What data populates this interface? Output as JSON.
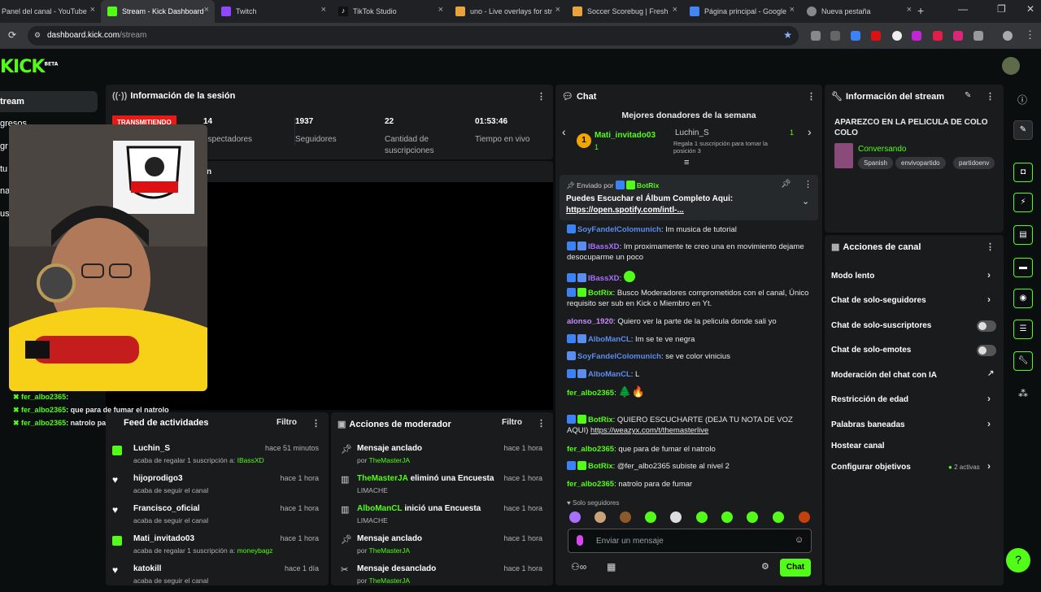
{
  "browser": {
    "tabs": [
      {
        "title": "Panel del canal - YouTube",
        "active": false
      },
      {
        "title": "Stream - Kick Dashboard",
        "active": true
      },
      {
        "title": "Twitch",
        "active": false
      },
      {
        "title": "TikTok Studio",
        "active": false
      },
      {
        "title": "uno - Live overlays for str",
        "active": false
      },
      {
        "title": "Soccer Scorebug | Fresh",
        "active": false
      },
      {
        "title": "Página principal - Google",
        "active": false
      },
      {
        "title": "Nueva pestaña",
        "active": false
      }
    ],
    "url_host": "dashboard.kick.com",
    "url_path": "/stream"
  },
  "app": {
    "logo": "KICK",
    "beta": "BETA"
  },
  "sidenav": {
    "items": [
      "tream",
      "gresos",
      "gr",
      "tu",
      "na",
      "us"
    ]
  },
  "session": {
    "title": "Información de la sesión",
    "live_label": "TRANSMITIENDO",
    "stats": [
      {
        "value": "14",
        "label": "espectadores"
      },
      {
        "value": "1937",
        "label": "Seguidores"
      },
      {
        "value": "22",
        "label": "Cantidad de suscripciones"
      },
      {
        "value": "01:53:46",
        "label": "Tiempo en vivo"
      }
    ],
    "preview_label": "n"
  },
  "overlay_chat": [
    {
      "user": "fer_albo2365",
      "text": ":"
    },
    {
      "user": "fer_albo2365",
      "text": ": que para de fumar el natrolo"
    },
    {
      "user": "fer_albo2365",
      "text": ": natrolo para de fumar"
    }
  ],
  "activity": {
    "title": "Feed de actividades",
    "filter": "Filtro",
    "items": [
      {
        "name": "Luchin_S",
        "time": "hace 51 minutos",
        "desc": "acaba de regalar 1 suscripción a:",
        "highlight": "IBassXD",
        "icon": "gift"
      },
      {
        "name": "hijoprodigo3",
        "time": "hace 1 hora",
        "desc": "acaba de seguir el canal",
        "highlight": "",
        "icon": "heart"
      },
      {
        "name": "Francisco_oficial",
        "time": "hace 1 hora",
        "desc": "acaba de seguir el canal",
        "highlight": "",
        "icon": "heart"
      },
      {
        "name": "Mati_invitado03",
        "time": "hace 1 hora",
        "desc": "acaba de regalar 1 suscripción a:",
        "highlight": "moneybagz",
        "icon": "gift"
      },
      {
        "name": "katokill",
        "time": "hace 1 día",
        "desc": "acaba de seguir el canal",
        "highlight": "",
        "icon": "heart"
      }
    ]
  },
  "moderator": {
    "title": "Acciones de moderador",
    "filter": "Filtro",
    "items": [
      {
        "actor": "",
        "action": "Mensaje anclado",
        "time": "hace 1 hora",
        "prefix": "por",
        "detail": "TheMasterJA"
      },
      {
        "actor": "TheMasterJA",
        "action": " eliminó una Encuesta",
        "time": "hace 1 hora",
        "prefix": "",
        "detail": "LIMACHE"
      },
      {
        "actor": "AlboManCL",
        "action": " inició una Encuesta",
        "time": "hace 1 hora",
        "prefix": "",
        "detail": "LIMACHE"
      },
      {
        "actor": "",
        "action": "Mensaje anclado",
        "time": "hace 1 hora",
        "prefix": "por",
        "detail": "TheMasterJA"
      },
      {
        "actor": "",
        "action": "Mensaje desanclado",
        "time": "hace 1 hora",
        "prefix": "por",
        "detail": "TheMasterJA"
      }
    ]
  },
  "chat": {
    "title": "Chat",
    "donors_title": "Mejores donadores de la semana",
    "donor1": {
      "rank": "1",
      "name": "Mati_invitado03",
      "count": "1"
    },
    "donor2": {
      "name": "Luchin_S",
      "count": "1",
      "note": "Regala 1 suscripción para tomar la posición 3"
    },
    "pinned": {
      "sent_by": "Enviado por",
      "user": "BotRix",
      "text": "Puedes Escuchar el Álbum Completo Aqui:",
      "link": "https://open.spotify.com/intl-..."
    },
    "messages": [
      {
        "user": "SoyFandelColomunich",
        "color": "#5b8def",
        "text": ": Im musica de tutorial"
      },
      {
        "user": "IBassXD",
        "color": "#a970ff",
        "text": ": Im proximamente te creo una en movimiento dejame desocuparme un poco"
      },
      {
        "user": "IBassXD",
        "color": "#a970ff",
        "text": ":"
      },
      {
        "user": "BotRix",
        "color": "#53fc18",
        "text": ": Busco Moderadores comprometidos con el canal, Único requisito ser sub en Kick o Miembro en Yt."
      },
      {
        "user": "alonso_1920",
        "color": "#c78bff",
        "text": ": Quiero ver la parte de la pelicula donde sali yo"
      },
      {
        "user": "AlboManCL",
        "color": "#5b8def",
        "text": ": Im se te ve negra"
      },
      {
        "user": "SoyFandelColomunich",
        "color": "#5b8def",
        "text": ": se ve color vinicius"
      },
      {
        "user": "AlboManCL",
        "color": "#5b8def",
        "text": ": L"
      },
      {
        "user": "fer_albo2365",
        "color": "#53fc18",
        "text": ":"
      },
      {
        "user": "BotRix",
        "color": "#53fc18",
        "text": ": QUIERO ESCUCHARTE (DEJA TU NOTA DE VOZ AQUI)",
        "link": "https://weazyx.com/t/themasterlive"
      },
      {
        "user": "fer_albo2365",
        "color": "#53fc18",
        "text": ": que para de fumar el natrolo"
      },
      {
        "user": "BotRix",
        "color": "#53fc18",
        "text": ": @fer_albo2365 subiste al nivel 2"
      },
      {
        "user": "fer_albo2365",
        "color": "#53fc18",
        "text": ": natrolo para de fumar"
      }
    ],
    "followers_only": "Solo seguidores",
    "input_placeholder": "Enviar un mensaje",
    "send_label": "Chat"
  },
  "stream_info": {
    "title": "Información del stream",
    "stream_title": "APAREZCO EN LA PELICULA DE COLO COLO",
    "category": "Conversando",
    "tags": [
      "Spanish",
      "envivopartido",
      "partidoenv"
    ]
  },
  "channel_actions": {
    "title": "Acciones de canal",
    "items": [
      {
        "label": "Modo lento",
        "type": "chevron"
      },
      {
        "label": "Chat de solo-seguidores",
        "type": "chevron"
      },
      {
        "label": "Chat de solo-suscriptores",
        "type": "toggle"
      },
      {
        "label": "Chat de solo-emotes",
        "type": "toggle"
      },
      {
        "label": "Moderación del chat con IA",
        "type": "external"
      },
      {
        "label": "Restricción de edad",
        "type": "chevron"
      },
      {
        "label": "Palabras baneadas",
        "type": "chevron"
      },
      {
        "label": "Hostear canal",
        "type": "none"
      },
      {
        "label": "Configurar objetivos",
        "type": "chevron",
        "badge": "2 activas"
      }
    ]
  },
  "colors": {
    "accent": "#53fc18",
    "live": "#e91916",
    "panel": "#191b1c",
    "bg": "#0b0e0f"
  }
}
